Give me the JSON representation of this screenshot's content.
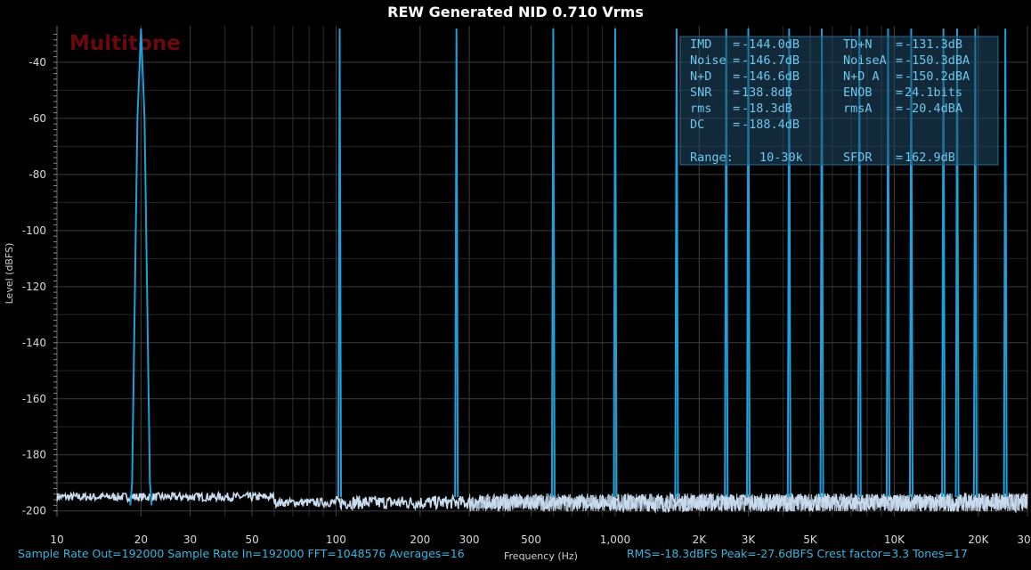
{
  "chart_data": {
    "type": "line",
    "title": "REW Generated NID 0.710 Vrms",
    "xlabel": "Frequency (Hz)",
    "ylabel": "Level (dBFS)",
    "x_scale": "log",
    "xlim": [
      10,
      30000
    ],
    "ylim": [
      -202,
      -27
    ],
    "grid": true,
    "watermark": "Multitone",
    "x_ticks": [
      {
        "value": 10,
        "label": "10"
      },
      {
        "value": 20,
        "label": "20"
      },
      {
        "value": 30,
        "label": "30"
      },
      {
        "value": 50,
        "label": "50"
      },
      {
        "value": 100,
        "label": "100"
      },
      {
        "value": 200,
        "label": "200"
      },
      {
        "value": 300,
        "label": "300"
      },
      {
        "value": 500,
        "label": "500"
      },
      {
        "value": 1000,
        "label": "1,000"
      },
      {
        "value": 2000,
        "label": "2K"
      },
      {
        "value": 3000,
        "label": "3K"
      },
      {
        "value": 5000,
        "label": "5K"
      },
      {
        "value": 10000,
        "label": "10K"
      },
      {
        "value": 20000,
        "label": "20K"
      },
      {
        "value": 30000,
        "label": "30K"
      }
    ],
    "y_ticks": [
      -40,
      -60,
      -80,
      -100,
      -120,
      -140,
      -160,
      -180,
      -200
    ],
    "series": [
      {
        "color": "#1ea0dc",
        "tones_hz": [
          20,
          103,
          270,
          600,
          1000,
          1660,
          2500,
          3000,
          4200,
          5500,
          7500,
          9500,
          11500,
          15000,
          16800,
          19500,
          25000
        ],
        "peak_db": [
          -28,
          -28,
          -28,
          -28,
          -28,
          -28,
          -28,
          -28,
          -28,
          -28,
          -28,
          -28,
          -28,
          -28,
          -28,
          -28,
          -28
        ]
      },
      {
        "color": "#c9dcef",
        "description_level_db": -197
      }
    ],
    "stats": [
      {
        "label": "IMD",
        "value": "-144.0dB",
        "label2": "TD+N",
        "value2": "-131.3dB"
      },
      {
        "label": "Noise",
        "value": "-146.7dB",
        "label2": "NoiseA",
        "value2": "-150.3dBA"
      },
      {
        "label": "N+D",
        "value": "-146.6dB",
        "label2": "N+D A",
        "value2": "-150.2dBA"
      },
      {
        "label": "SNR",
        "value": "138.8dB",
        "label2": "ENOB",
        "value2": "24.1bits"
      },
      {
        "label": "rms",
        "value": "-18.3dB",
        "label2": "rmsA",
        "value2": "-20.4dBA"
      },
      {
        "label": "DC",
        "value": "-188.4dB",
        "label2": "",
        "value2": ""
      },
      {
        "label": "Range:",
        "value": "10-30k",
        "label2": "SFDR",
        "value2": "162.9dB"
      }
    ]
  },
  "status": {
    "left": "Sample Rate Out=192000  Sample Rate In=192000  FFT=1048576  Averages=16",
    "right": "RMS=-18.3dBFS  Peak=-27.6dBFS  Crest factor=3.3  Tones=17"
  },
  "colors": {
    "background": "#000000",
    "grid": "#3a3a3a",
    "tone_line": "#1ea0dc",
    "noise_floor": "#c9dcef",
    "stats_box": "#1f4a66",
    "watermark": "#6a0a0a"
  }
}
